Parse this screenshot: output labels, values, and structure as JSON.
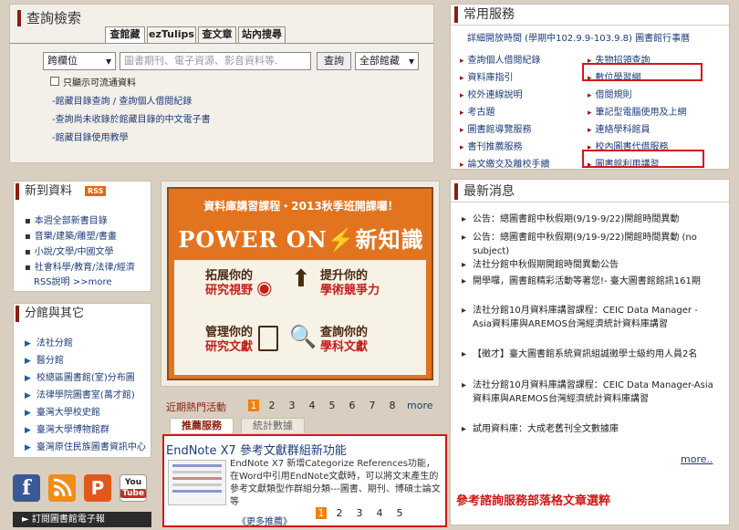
{
  "search": {
    "title": "查詢檢索",
    "tabs": [
      "查館藏",
      "ezTulips",
      "查文章",
      "站內搜尋"
    ],
    "field_select": "跨欄位",
    "placeholder": "圖書期刊、電子資源、影音資料等.",
    "button": "查詢",
    "scope_select": "全部館藏",
    "checkbox_label": "只顯示可流通資料",
    "links": [
      "-館藏目錄查詢 / 查詢個人借閱紀錄",
      "-查詢尚未收錄於館藏目錄的中文電子書",
      "-館藏目錄使用教學"
    ]
  },
  "services": {
    "title": "常用服務",
    "hours": "詳細開放時間 (學期中102.9.9-103.9.8) 圖書館行事曆",
    "left": [
      "查詢個人借閱紀錄",
      "資料庫指引",
      "校外連線說明",
      "考古題",
      "圖書館導覽服務",
      "書刊推薦服務",
      "論文繳交及離校手續"
    ],
    "right": [
      "失物招領查詢",
      "數位學習網",
      "借閱規則",
      "筆記型電腦使用及上網",
      "連絡學科館員",
      "校內圖書代借服務",
      "圖書館利用講習"
    ]
  },
  "new_resources": {
    "title": "新到資料",
    "rss": "RSS",
    "items": [
      "本週全部新書目錄",
      "音樂/建築/雕塑/書畫",
      "小說/文學/中國文學",
      "社會科學/教育/法律/經濟"
    ],
    "rss_desc": "RSS說明 >>more"
  },
  "branches": {
    "title": "分館與其它",
    "items": [
      "法社分館",
      "醫分館",
      "校總區圖書館(室)分布圖",
      "法律學院圖書室(萬才館)",
      "臺灣大學校史館",
      "臺灣大學博物館群",
      "臺灣原住民族圖書資訊中心"
    ]
  },
  "social": {
    "icons": [
      "facebook-icon",
      "rss-icon",
      "plurk-icon",
      "youtube-icon"
    ],
    "youtube_text": "You\nTube",
    "subscribe": "► 訂閱圖書館電子報"
  },
  "banner": {
    "title": "資料庫講習課程・2013秋季班開課囉！",
    "power": "POWER ON",
    "power_tail": "新知識",
    "q1a": "拓展你的",
    "q1b": "研究視野",
    "q2a": "提升你的",
    "q2b": "學術競爭力",
    "q3a": "管理你的",
    "q3b": "研究文獻",
    "q4a": "查詢你的",
    "q4b": "學科文獻"
  },
  "activity": {
    "label": "近期熱門活動",
    "pages": [
      "1",
      "2",
      "3",
      "4",
      "5",
      "6",
      "7",
      "8"
    ],
    "more": "more"
  },
  "recommend": {
    "tabs": [
      "推薦服務",
      "統計數據"
    ],
    "heading": "EndNote X7 參考文獻群組新功能",
    "body": "EndNote X7 新增Categorize References功能，在Word中引用EndNote文獻時，可以將文末產生的參考文獻類型作群組分類---圖書、期刊、博碩士論文等",
    "more": "《更多推薦》",
    "pages": [
      "1",
      "2",
      "3",
      "4",
      "5"
    ]
  },
  "annotation": "參考諮詢服務部落格文章選粹",
  "news": {
    "title": "最新消息",
    "items": [
      "公告：總圖書館中秋假期(9/19-9/22)開館時間異動",
      "公告：總圖書館中秋假期(9/19-9/22)開館時間異動 (no subject)",
      "法社分館中秋假期開館時間異動公告",
      "開學囉，圖書館精彩活動等著您!- 臺大圖書館館訊161期",
      "法社分館10月資料庫講習課程：CEIC Data Manager - Asia資料庫與AREMOS台灣經濟統計資料庫講習",
      "【徵才】臺大圖書館系統資訊組誠徵學士級約用人員2名",
      "法社分館10月資料庫講習課程：CEIC Data Manager-Asia資料庫與AREMOS台灣經濟統計資料庫講習",
      "試用資料庫：大成老舊刊全文數據庫"
    ],
    "more": "more.."
  },
  "colors": {
    "accent": "#8a1d12",
    "link": "#1d3c78",
    "highlight": "#d01818",
    "banner_orange": "#e06010"
  }
}
